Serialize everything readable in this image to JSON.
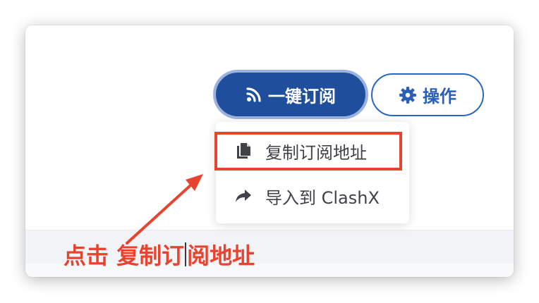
{
  "buttons": {
    "subscribe_label": "一键订阅",
    "actions_label": "操作"
  },
  "menu": {
    "items": [
      {
        "label": "复制订阅地址",
        "icon": "copy-icon"
      },
      {
        "label": "导入到 ClashX",
        "icon": "share-forward-icon"
      }
    ]
  },
  "annotation": {
    "prefix": "点击 ",
    "part1": "复制订",
    "part2": "阅地址"
  },
  "colors": {
    "primary": "#1f4f9c",
    "primary_ring": "#9bb3de",
    "outline": "#2a66c4",
    "highlight": "#e8432e",
    "menu_text": "#3f4249"
  },
  "icons": {
    "subscribe": "rss-icon",
    "actions": "gear-icon",
    "annotation_arrow": "arrow-icon"
  }
}
